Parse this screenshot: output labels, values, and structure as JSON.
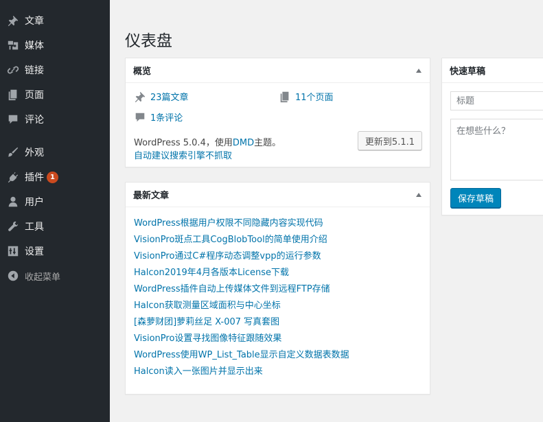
{
  "sidebar": {
    "items": [
      {
        "label": "文章"
      },
      {
        "label": "媒体"
      },
      {
        "label": "链接"
      },
      {
        "label": "页面"
      },
      {
        "label": "评论"
      },
      {
        "label": "外观"
      },
      {
        "label": "插件",
        "badge": "1"
      },
      {
        "label": "用户"
      },
      {
        "label": "工具"
      },
      {
        "label": "设置"
      },
      {
        "label": "收起菜单"
      }
    ]
  },
  "page": {
    "title": "仪表盘"
  },
  "overview": {
    "title": "概览",
    "posts": "23篇文章",
    "pages": "11个页面",
    "comments": "1条评论",
    "version_prefix": "WordPress 5.0.4，使用",
    "theme": "DMD",
    "version_suffix": "主题。",
    "seo_notice": "自动建议搜索引擎不抓取",
    "update_button": "更新到5.1.1"
  },
  "recent": {
    "title": "最新文章",
    "items": [
      "WordPress根据用户权限不同隐藏内容实现代码",
      "VisionPro斑点工具CogBlobTool的简单使用介绍",
      "VisionPro通过C#程序动态调整vpp的运行参数",
      "Halcon2019年4月各版本License下载",
      "WordPress插件自动上传媒体文件到远程FTP存储",
      "Halcon获取测量区域面积与中心坐标",
      "[森萝财团]萝莉丝足 X-007 写真套图",
      "VisionPro设置寻找图像特征跟随效果",
      "WordPress使用WP_List_Table显示自定义数据表数据",
      "Halcon读入一张图片并显示出来"
    ]
  },
  "quick_draft": {
    "title": "快速草稿",
    "title_placeholder": "标题",
    "content_placeholder": "在想些什么？",
    "save_button": "保存草稿"
  },
  "colors": {
    "sidebar_bg": "#23282d",
    "link": "#0073aa",
    "primary_button": "#0085ba",
    "badge": "#ca4a1f"
  }
}
